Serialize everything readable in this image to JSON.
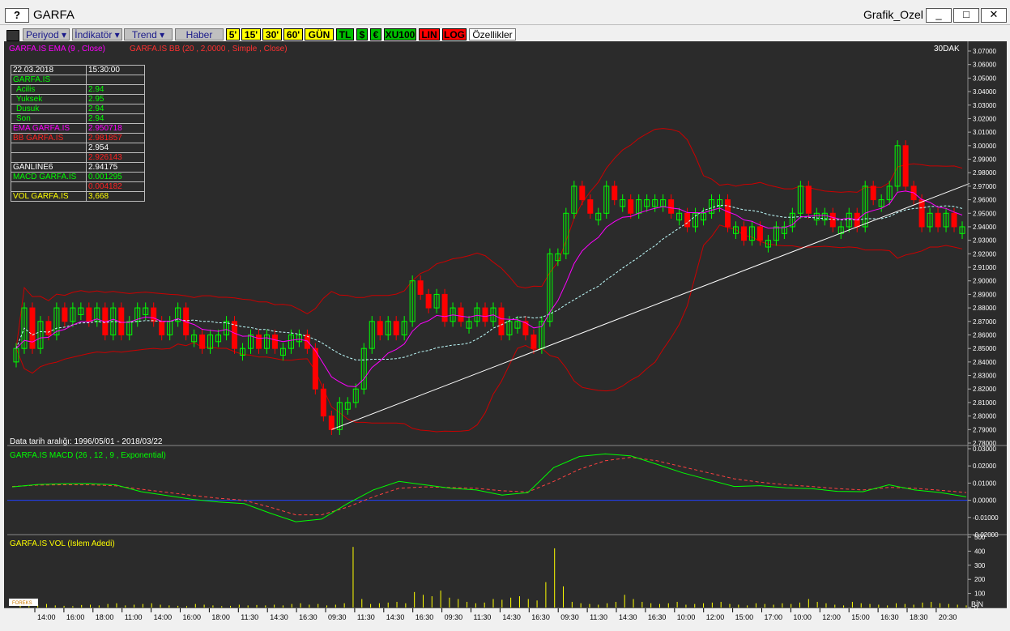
{
  "window": {
    "help_label": "?",
    "title": "GARFA",
    "right_title": "Grafik_Ozel",
    "min_label": "_",
    "max_label": "□",
    "close_label": "✕"
  },
  "toolbar": {
    "icon": "chart-icon",
    "buttons": [
      "Periyod ▾",
      "İndikatör ▾",
      "Trend ▾",
      "Haber"
    ],
    "periods": [
      "5'",
      "15'",
      "30'",
      "60'",
      "GÜN"
    ],
    "currency": [
      "TL",
      "$",
      "€",
      "XU100"
    ],
    "scale": [
      "LIN",
      "LOG"
    ],
    "props": "Özellikler"
  },
  "main": {
    "legend_ema": "GARFA.IS EMA (9 , Close)",
    "legend_bb": "GARFA.IS BB (20 , 2,0000 , Simple , Close)",
    "period_tag": "30DAK",
    "date_range": "Data tarih aralığı: 1996/05/01 - 2018/03/22"
  },
  "info": [
    {
      "label": "22.03.2018",
      "value": "15:30:00",
      "lc": "#ffffff",
      "vc": "#ffffff"
    },
    {
      "label": "GARFA.IS",
      "value": "",
      "lc": "#00ff00",
      "vc": "#00ff00"
    },
    {
      "label": "Acilis",
      "value": "2.94",
      "lc": "#00ff00",
      "vc": "#00ff00",
      "indent": true
    },
    {
      "label": "Yuksek",
      "value": "2.95",
      "lc": "#00ff00",
      "vc": "#00ff00",
      "indent": true
    },
    {
      "label": "Dusuk",
      "value": "2.94",
      "lc": "#00ff00",
      "vc": "#00ff00",
      "indent": true
    },
    {
      "label": "Son",
      "value": "2.94",
      "lc": "#00ff00",
      "vc": "#00ff00",
      "indent": true
    },
    {
      "label": "EMA GARFA.IS",
      "value": "2.950718",
      "lc": "#ff00ff",
      "vc": "#ff00ff"
    },
    {
      "label": "BB GARFA.IS",
      "value": "2.981857",
      "lc": "#ff2020",
      "vc": "#ff2020"
    },
    {
      "label": "",
      "value": "2.954",
      "lc": "#ffffff",
      "vc": "#ffffff"
    },
    {
      "label": "",
      "value": "2.926143",
      "lc": "#ff2020",
      "vc": "#ff2020"
    },
    {
      "label": "GANLINE6",
      "value": "2.94175",
      "lc": "#ffffff",
      "vc": "#ffffff"
    },
    {
      "label": "MACD GARFA.IS",
      "value": "0.001295",
      "lc": "#00ff00",
      "vc": "#00ff00"
    },
    {
      "label": "",
      "value": "0.004182",
      "lc": "#ff2020",
      "vc": "#ff2020"
    },
    {
      "label": "VOL GARFA.IS",
      "value": "3,668",
      "lc": "#ffff00",
      "vc": "#ffff00"
    }
  ],
  "macd_panel": {
    "title": "GARFA.IS MACD (26 , 12 , 9 , Exponential)"
  },
  "vol_panel": {
    "title": "GARFA.IS VOL (Islem Adedi)",
    "bin_label": "BİN",
    "logo": "FOREKS"
  },
  "colors": {
    "bg": "#2b2b2b",
    "bull": "#00ff00",
    "bear": "#ff0000",
    "bb": "#cc0000",
    "ema": "#ff00ff",
    "mid": "#c0ffff",
    "macd": "#00ff00",
    "signal": "#ff4040",
    "vol": "#ffff00",
    "trend": "#ffffff"
  },
  "chart_data": [
    {
      "type": "candlestick",
      "ylim": [
        2.78,
        3.07
      ],
      "yticks": [
        "3.07000",
        "3.06000",
        "3.05000",
        "3.04000",
        "3.03000",
        "3.02000",
        "3.01000",
        "3.00000",
        "2.99000",
        "2.98000",
        "2.97000",
        "2.96000",
        "2.95000",
        "2.94000",
        "2.93000",
        "2.92000",
        "2.91000",
        "2.90000",
        "2.89000",
        "2.88000",
        "2.87000",
        "2.86000",
        "2.85000",
        "2.84000",
        "2.83000",
        "2.82000",
        "2.81000",
        "2.80000",
        "2.79000",
        "2.78000"
      ],
      "xticks": [
        "14:00",
        "16:00",
        "18:00",
        "11:00",
        "14:00",
        "16:00",
        "18:00",
        "11:30",
        "14:30",
        "16:30",
        "09:30",
        "11:30",
        "14:30",
        "16:30",
        "09:30",
        "11:30",
        "14:30",
        "16:30",
        "09:30",
        "11:30",
        "14:30",
        "16:30",
        "10:00",
        "12:00",
        "15:00",
        "17:00",
        "10:00",
        "12:00",
        "15:00",
        "16:30",
        "18:30",
        "20:30"
      ],
      "close": [
        2.85,
        2.88,
        2.85,
        2.87,
        2.86,
        2.88,
        2.87,
        2.88,
        2.88,
        2.87,
        2.88,
        2.86,
        2.88,
        2.86,
        2.87,
        2.88,
        2.88,
        2.87,
        2.86,
        2.87,
        2.88,
        2.86,
        2.86,
        2.85,
        2.86,
        2.86,
        2.87,
        2.85,
        2.85,
        2.86,
        2.85,
        2.86,
        2.85,
        2.85,
        2.86,
        2.86,
        2.85,
        2.82,
        2.8,
        2.79,
        2.81,
        2.81,
        2.82,
        2.85,
        2.87,
        2.86,
        2.87,
        2.86,
        2.87,
        2.9,
        2.89,
        2.88,
        2.89,
        2.87,
        2.88,
        2.87,
        2.87,
        2.88,
        2.87,
        2.88,
        2.86,
        2.87,
        2.87,
        2.86,
        2.85,
        2.87,
        2.92,
        2.92,
        2.95,
        2.97,
        2.96,
        2.95,
        2.95,
        2.97,
        2.96,
        2.96,
        2.95,
        2.96,
        2.96,
        2.96,
        2.96,
        2.95,
        2.95,
        2.94,
        2.95,
        2.95,
        2.96,
        2.96,
        2.94,
        2.94,
        2.93,
        2.94,
        2.93,
        2.93,
        2.94,
        2.94,
        2.95,
        2.97,
        2.95,
        2.95,
        2.95,
        2.94,
        2.94,
        2.95,
        2.94,
        2.97,
        2.96,
        2.96,
        2.97,
        3.0,
        2.97,
        2.96,
        2.94,
        2.95,
        2.94,
        2.95,
        2.94,
        2.94
      ],
      "macd": [
        0.0078,
        0.0092,
        0.0096,
        0.0097,
        0.009,
        0.005,
        0.0028,
        0.0005,
        -0.001,
        -0.002,
        -0.0075,
        -0.0125,
        -0.011,
        -0.002,
        0.006,
        0.011,
        0.009,
        0.007,
        0.006,
        0.003,
        0.0045,
        0.019,
        0.0255,
        0.027,
        0.0258,
        0.021,
        0.016,
        0.012,
        0.008,
        0.0085,
        0.0072,
        0.0068,
        0.0052,
        0.005,
        0.009,
        0.006,
        0.0045,
        0.002
      ],
      "signal": [
        0.008,
        0.0088,
        0.009,
        0.009,
        0.0084,
        0.0064,
        0.0046,
        0.0028,
        0.0012,
        0.0,
        -0.004,
        -0.0085,
        -0.0085,
        -0.004,
        0.002,
        0.007,
        0.0078,
        0.0074,
        0.007,
        0.0055,
        0.0048,
        0.011,
        0.018,
        0.023,
        0.025,
        0.023,
        0.0195,
        0.016,
        0.0125,
        0.0105,
        0.009,
        0.008,
        0.0068,
        0.006,
        0.0075,
        0.007,
        0.0058,
        0.0045
      ],
      "macd_ylim": [
        -0.02,
        0.03
      ],
      "macd_yticks": [
        "0.03000",
        "0.02000",
        "0.01000",
        "0.00000",
        "-0.01000",
        "-0.02000"
      ],
      "volume": [
        15,
        10,
        20,
        25,
        15,
        12,
        10,
        18,
        20,
        15,
        25,
        30,
        15,
        20,
        25,
        30,
        20,
        15,
        12,
        10,
        25,
        20,
        15,
        10,
        12,
        20,
        15,
        18,
        15,
        20,
        15,
        25,
        30,
        20,
        25,
        15,
        20,
        30,
        430,
        60,
        25,
        30,
        35,
        40,
        30,
        110,
        90,
        80,
        120,
        70,
        60,
        40,
        30,
        35,
        60,
        55,
        70,
        80,
        60,
        50,
        180,
        420,
        150,
        40,
        30,
        25,
        20,
        30,
        40,
        90,
        60,
        40,
        30,
        25,
        30,
        40,
        20,
        25,
        30,
        35,
        40,
        25,
        20,
        15,
        30,
        25,
        20,
        30,
        25,
        35,
        60,
        40,
        30,
        20,
        15,
        40,
        30,
        25,
        20,
        15,
        30,
        25,
        20,
        35,
        40,
        30,
        25,
        20,
        15
      ],
      "vol_ylim": [
        0,
        500
      ],
      "vol_yticks": [
        "500",
        "400",
        "300",
        "200",
        "100",
        "0"
      ]
    }
  ]
}
